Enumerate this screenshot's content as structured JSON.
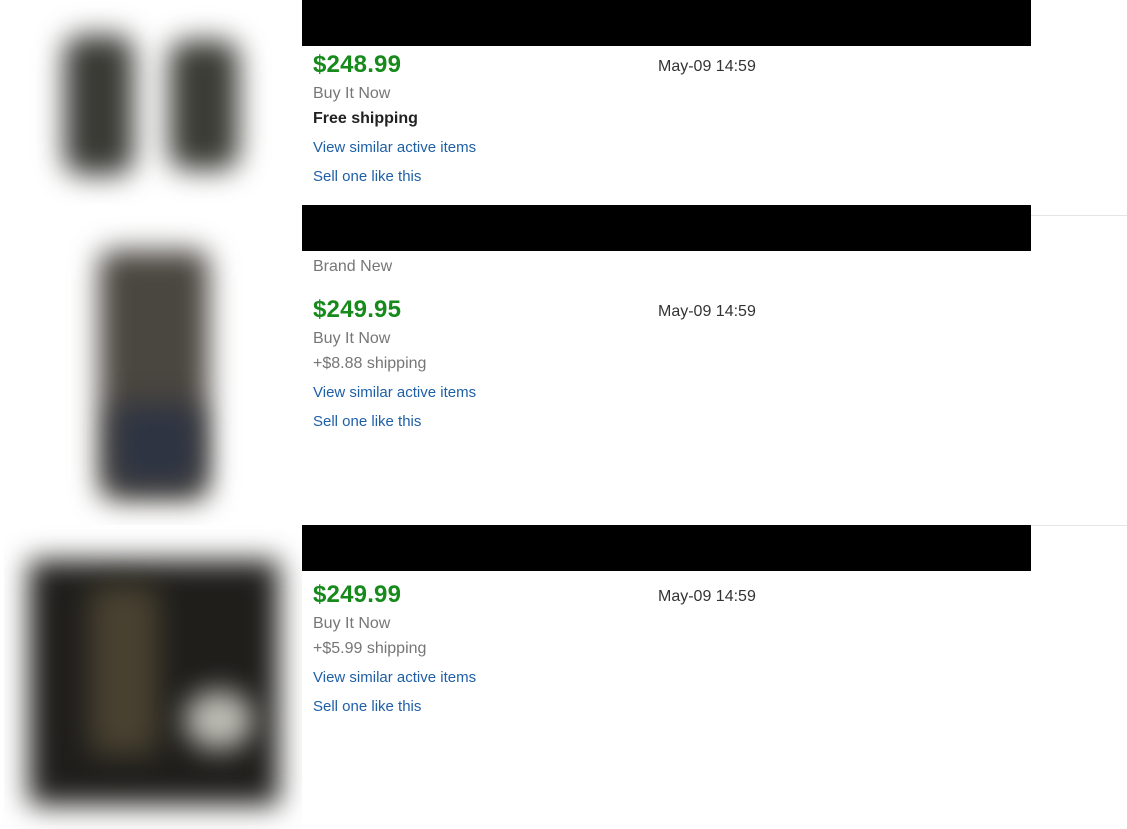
{
  "listings": [
    {
      "price": "$248.99",
      "date": "May-09 14:59",
      "format": "Buy It Now",
      "shipping": "Free shipping",
      "view_similar": "View similar active items",
      "sell_one": "Sell one like this"
    },
    {
      "condition": "Brand New",
      "price": "$249.95",
      "date": "May-09 14:59",
      "format": "Buy It Now",
      "shipping": "+$8.88 shipping",
      "view_similar": "View similar active items",
      "sell_one": "Sell one like this"
    },
    {
      "price": "$249.99",
      "date": "May-09 14:59",
      "format": "Buy It Now",
      "shipping": "+$5.99 shipping",
      "view_similar": "View similar active items",
      "sell_one": "Sell one like this"
    }
  ],
  "colors": {
    "price": "#168a1a",
    "link": "#1e5fa6",
    "muted": "#767676",
    "redaction": "#000000"
  }
}
